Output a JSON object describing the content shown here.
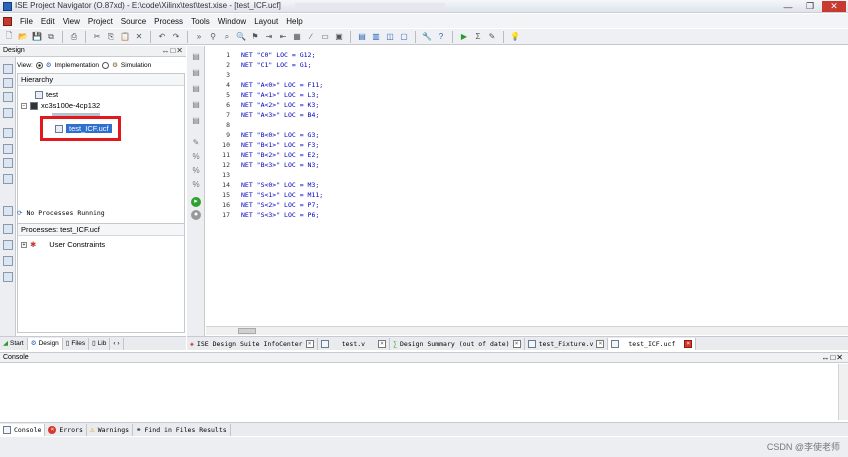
{
  "window": {
    "title": "ISE Project Navigator (O.87xd) - E:\\code\\Xilinx\\test\\test.xise - [test_ICF.ucf]"
  },
  "menu": [
    "File",
    "Edit",
    "View",
    "Project",
    "Source",
    "Process",
    "Tools",
    "Window",
    "Layout",
    "Help"
  ],
  "design_panel": {
    "title": "Design",
    "view_label": "View:",
    "view_implementation": "Implementation",
    "view_simulation": "Simulation",
    "hierarchy_title": "Hierarchy",
    "tree": [
      "test",
      "xc3s100e-4cp132",
      "test_ICF.ucf"
    ],
    "no_processes": "No Processes Running",
    "processes_title": "Processes: test_ICF.ucf",
    "processes": [
      "User Constraints"
    ]
  },
  "left_tabs": [
    "Start",
    "Design",
    "Files",
    "Lib"
  ],
  "editor": {
    "lines": [
      {
        "n": "1",
        "text": "NET \"C0\" LOC = G12;"
      },
      {
        "n": "2",
        "text": "NET \"C1\" LOC = G1;"
      },
      {
        "n": "3",
        "text": ""
      },
      {
        "n": "4",
        "text": "NET \"A<0>\" LOC = F11;"
      },
      {
        "n": "5",
        "text": "NET \"A<1>\" LOC = L3;"
      },
      {
        "n": "6",
        "text": "NET \"A<2>\" LOC = K3;"
      },
      {
        "n": "7",
        "text": "NET \"A<3>\" LOC = B4;"
      },
      {
        "n": "8",
        "text": ""
      },
      {
        "n": "9",
        "text": "NET \"B<0>\" LOC = G3;"
      },
      {
        "n": "10",
        "text": "NET \"B<1>\" LOC = F3;"
      },
      {
        "n": "11",
        "text": "NET \"B<2>\" LOC = E2;"
      },
      {
        "n": "12",
        "text": "NET \"B<3>\" LOC = N3;"
      },
      {
        "n": "13",
        "text": ""
      },
      {
        "n": "14",
        "text": "NET \"S<0>\" LOC = M3;"
      },
      {
        "n": "15",
        "text": "NET \"S<1>\" LOC = M11;"
      },
      {
        "n": "16",
        "text": "NET \"S<2>\" LOC = P7;"
      },
      {
        "n": "17",
        "text": "NET \"S<3>\" LOC = P6;"
      }
    ]
  },
  "doc_tabs": [
    "ISE Design Suite InfoCenter",
    "test.v",
    "Design Summary (out of date)",
    "test_Fixture.v",
    "test_ICF.ucf"
  ],
  "console": {
    "title": "Console"
  },
  "console_tabs": [
    "Console",
    "Errors",
    "Warnings",
    "Find in Files Results"
  ],
  "watermark": "CSDN @李使老师"
}
